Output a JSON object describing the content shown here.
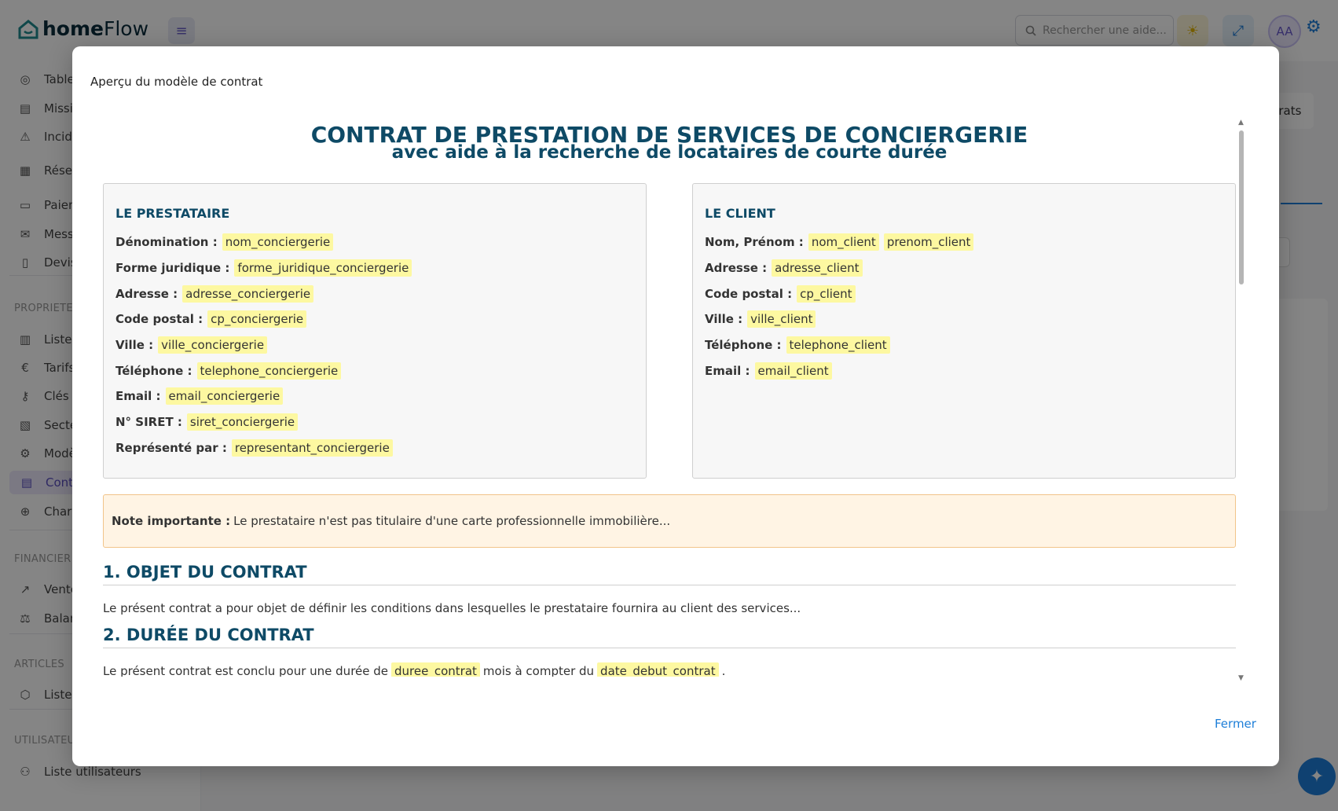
{
  "app": {
    "logo_bold": "home",
    "logo_regular": "Flow"
  },
  "topbar": {
    "search_placeholder": "Rechercher une aide...",
    "avatar_initials": "AA"
  },
  "sidebar": {
    "items": [
      {
        "label": "Tableau de bord",
        "icon": "dashboard-icon",
        "symbol": "◎"
      },
      {
        "label": "Missions",
        "icon": "clipboard-icon",
        "symbol": "▤"
      },
      {
        "label": "Incidents",
        "icon": "warning-icon",
        "symbol": "⚠"
      },
      {
        "label": "Réservations",
        "icon": "calendar-icon",
        "symbol": "▦"
      },
      {
        "label": "Paiements",
        "icon": "card-icon",
        "symbol": "▭"
      },
      {
        "label": "Messages",
        "icon": "mail-icon",
        "symbol": "✉"
      },
      {
        "label": "Devis",
        "icon": "document-icon",
        "symbol": "▯"
      }
    ],
    "section_properties": "PROPRIETES",
    "items_properties": [
      {
        "label": "Liste",
        "icon": "building-icon",
        "symbol": "▥"
      },
      {
        "label": "Tarifs",
        "icon": "euro-icon",
        "symbol": "€"
      },
      {
        "label": "Clés",
        "icon": "key-icon",
        "symbol": "⚷"
      },
      {
        "label": "Secteurs",
        "icon": "map-icon",
        "symbol": "▧"
      },
      {
        "label": "Modèles",
        "icon": "gear-icon",
        "symbol": "⚙"
      },
      {
        "label": "Contrats",
        "icon": "contract-icon",
        "symbol": "▤"
      },
      {
        "label": "Charges",
        "icon": "globe-icon",
        "symbol": "⊕"
      }
    ],
    "section_financier": "FINANCIER",
    "items_financier": [
      {
        "label": "Ventes",
        "icon": "trend-icon",
        "symbol": "↗"
      },
      {
        "label": "Balance",
        "icon": "scale-icon",
        "symbol": "⚖"
      }
    ],
    "section_articles": "ARTICLES",
    "items_articles": [
      {
        "label": "Liste",
        "icon": "box-icon",
        "symbol": "⬡"
      }
    ],
    "section_users": "UTILISATEURS",
    "items_users": [
      {
        "label": "Liste utilisateurs",
        "icon": "users-icon",
        "symbol": "⚇"
      }
    ]
  },
  "background": {
    "tab_label": "ntrats"
  },
  "modal": {
    "title": "Aperçu du modèle de contrat",
    "close_label": "Fermer",
    "doc_title": "CONTRAT DE PRESTATION DE SERVICES DE CONCIERGERIE",
    "doc_subtitle": "avec aide à la recherche de locataires de courte durée",
    "prestataire": {
      "title": "LE PRESTATAIRE",
      "rows": [
        {
          "label": "Dénomination :",
          "values": [
            "nom_conciergerie"
          ]
        },
        {
          "label": "Forme juridique :",
          "values": [
            "forme_juridique_conciergerie"
          ]
        },
        {
          "label": "Adresse :",
          "values": [
            "adresse_conciergerie"
          ]
        },
        {
          "label": "Code postal :",
          "values": [
            "cp_conciergerie"
          ]
        },
        {
          "label": "Ville :",
          "values": [
            "ville_conciergerie"
          ]
        },
        {
          "label": "Téléphone :",
          "values": [
            "telephone_conciergerie"
          ]
        },
        {
          "label": "Email :",
          "values": [
            "email_conciergerie"
          ]
        },
        {
          "label": "N° SIRET :",
          "values": [
            "siret_conciergerie"
          ]
        },
        {
          "label": "Représenté par :",
          "values": [
            "representant_conciergerie"
          ]
        }
      ]
    },
    "client": {
      "title": "LE CLIENT",
      "rows": [
        {
          "label": "Nom, Prénom :",
          "values": [
            "nom_client",
            "prenom_client"
          ]
        },
        {
          "label": "Adresse :",
          "values": [
            "adresse_client"
          ]
        },
        {
          "label": "Code postal :",
          "values": [
            "cp_client"
          ]
        },
        {
          "label": "Ville :",
          "values": [
            "ville_client"
          ]
        },
        {
          "label": "Téléphone :",
          "values": [
            "telephone_client"
          ]
        },
        {
          "label": "Email :",
          "values": [
            "email_client"
          ]
        }
      ]
    },
    "note": {
      "label": "Note importante :",
      "text": "Le prestataire n'est pas titulaire d'une carte professionnelle immobilière..."
    },
    "section1": {
      "title": "1. OBJET DU CONTRAT",
      "text": "Le présent contrat a pour objet de définir les conditions dans lesquelles le prestataire fournira au client des services..."
    },
    "section2": {
      "title": "2. DURÉE DU CONTRAT",
      "text_a": "Le présent contrat est conclu pour une durée de",
      "ph_a": "duree_contrat",
      "text_b": "mois à compter du",
      "ph_b": "date_debut_contrat",
      "text_c": "."
    }
  }
}
